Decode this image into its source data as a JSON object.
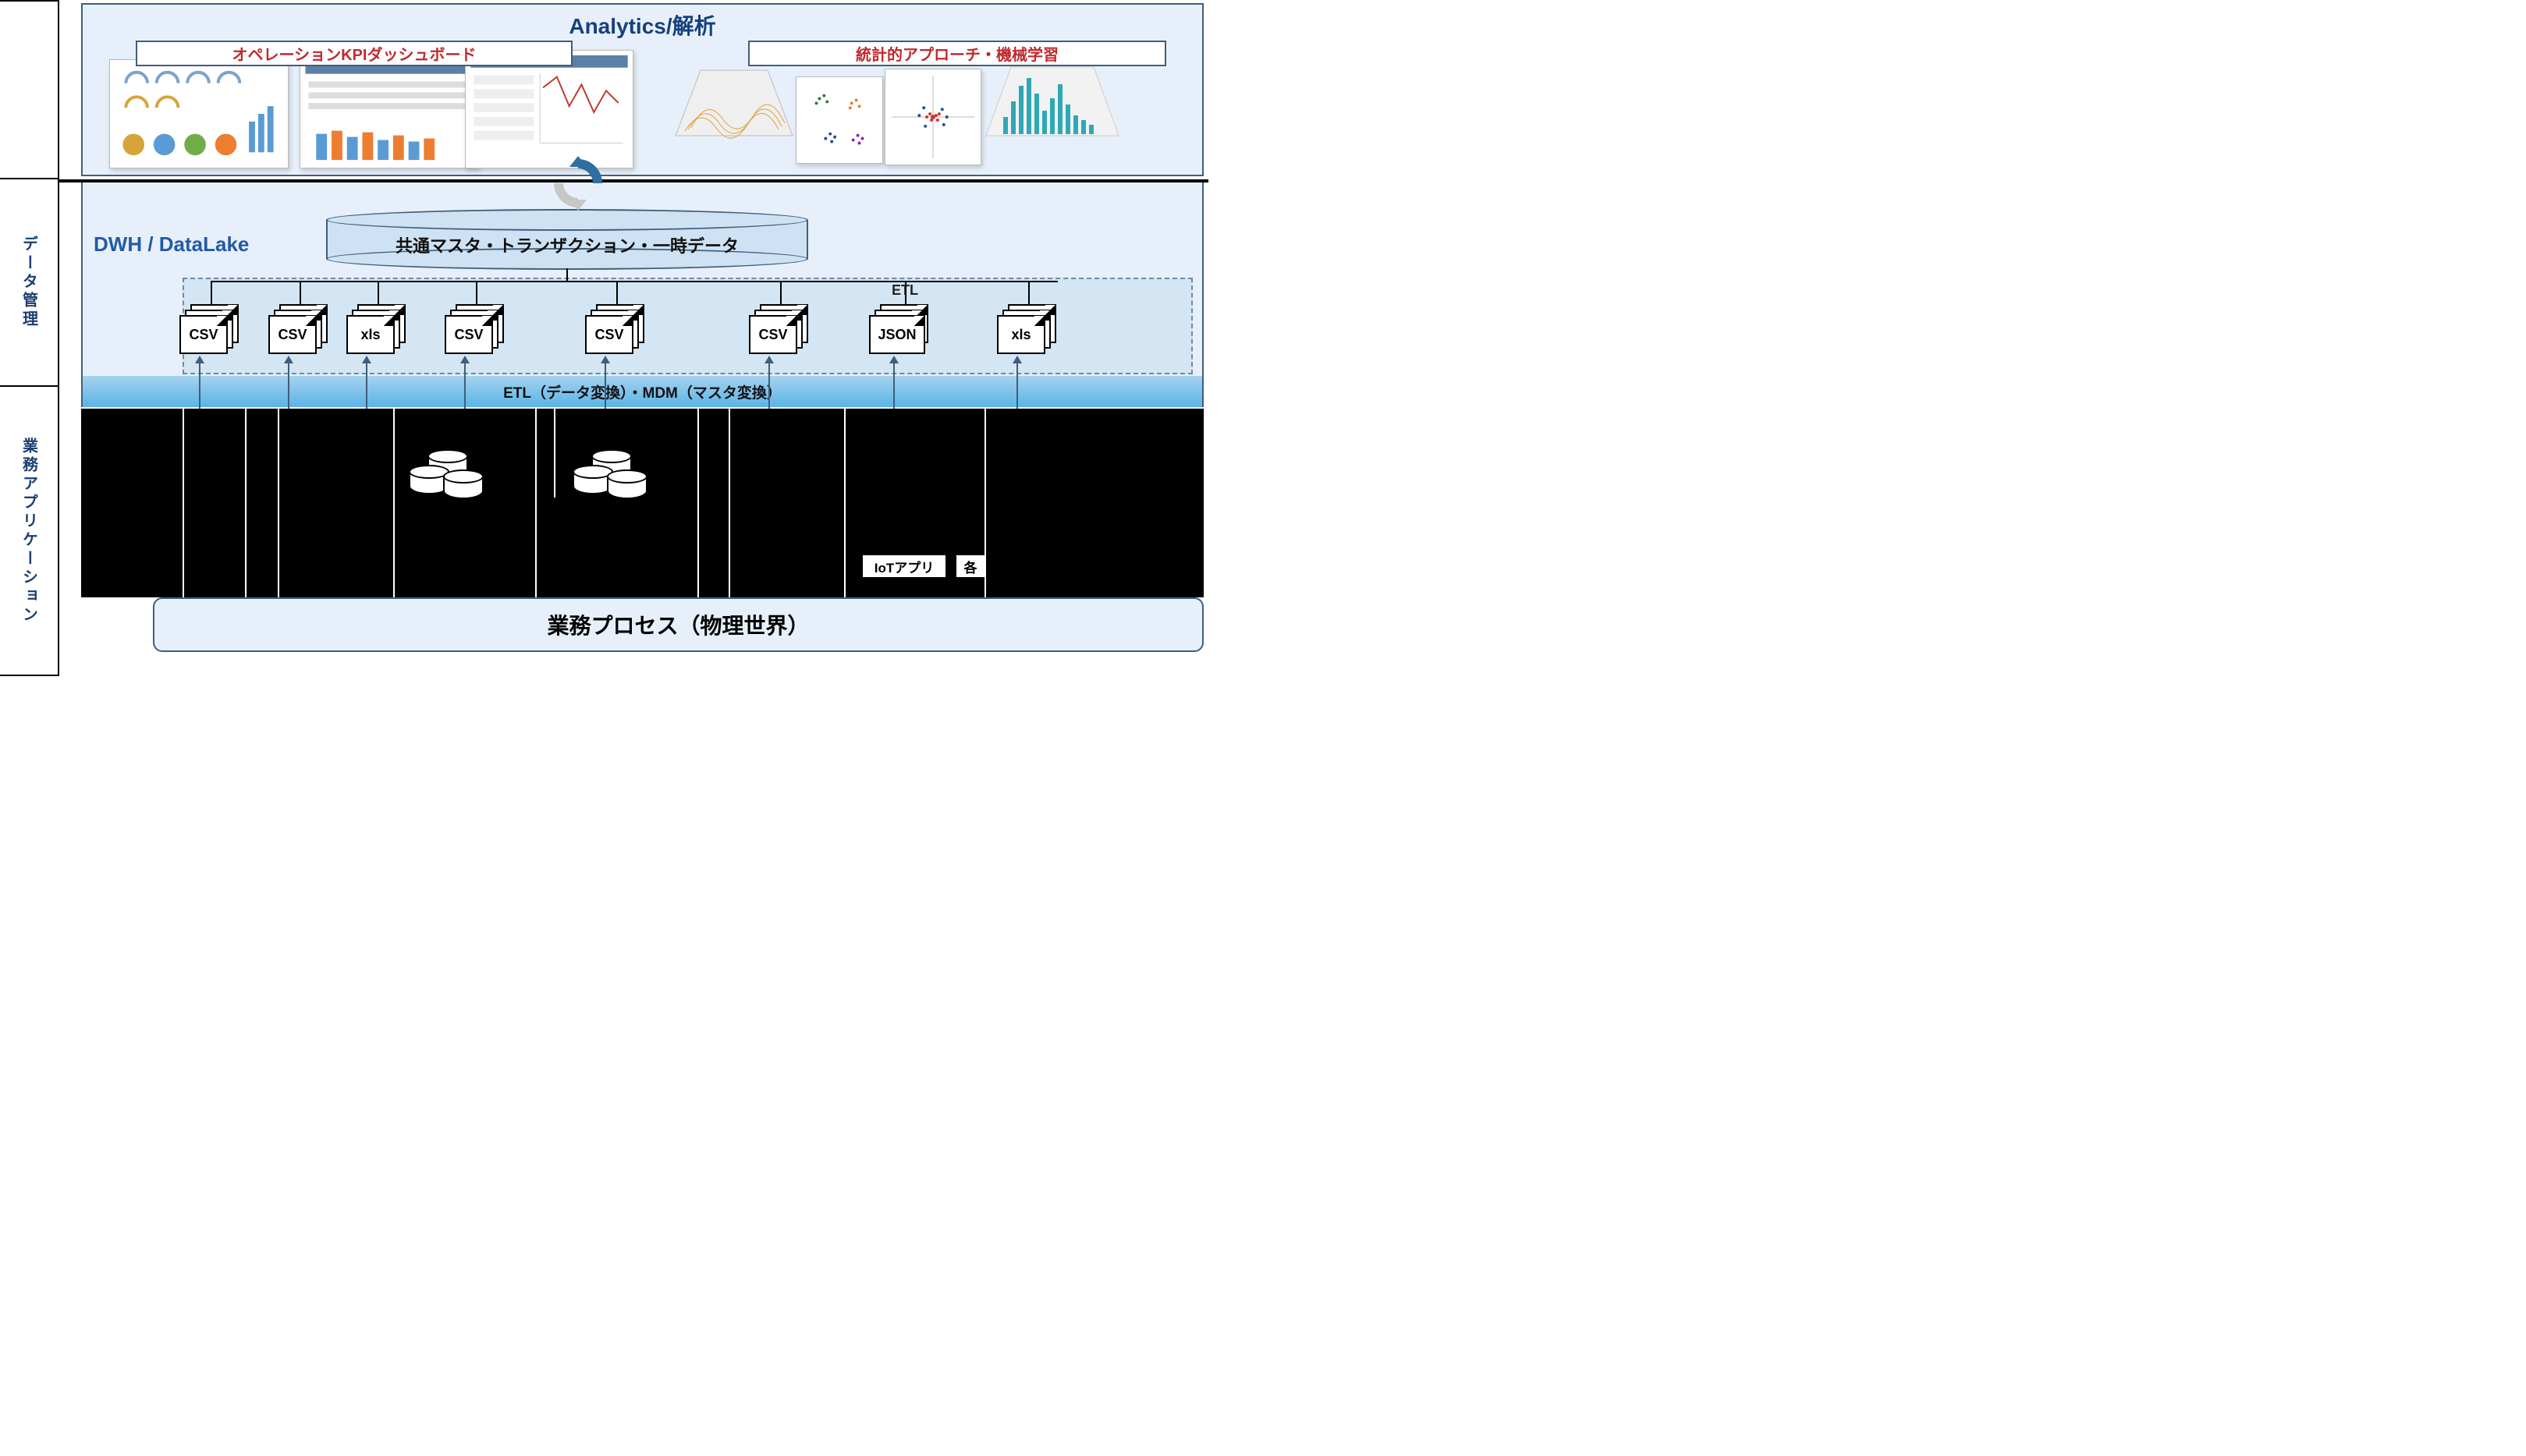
{
  "sidebar": {
    "top": "",
    "mid": "データ管理",
    "bot": "業務アプリケーション"
  },
  "analytics": {
    "title": "Analytics/解析",
    "left_heading": "オペレーションKPIダッシュボード",
    "right_heading": "統計的アプローチ・機械学習"
  },
  "dwh": {
    "label": "DWH / DataLake",
    "cylinder_text": "共通マスタ・トランザクション・一時データ",
    "etl_label": "ETL"
  },
  "files": [
    "CSV",
    "CSV",
    "xls",
    "CSV",
    "CSV",
    "CSV",
    "JSON",
    "xls"
  ],
  "etl2_label": "ETL（データ変換）・MDM（マスタ変換）",
  "apps": {
    "iot": "IoTアプリ",
    "each": "各"
  },
  "process_label": "業務プロセス（物理世界）"
}
